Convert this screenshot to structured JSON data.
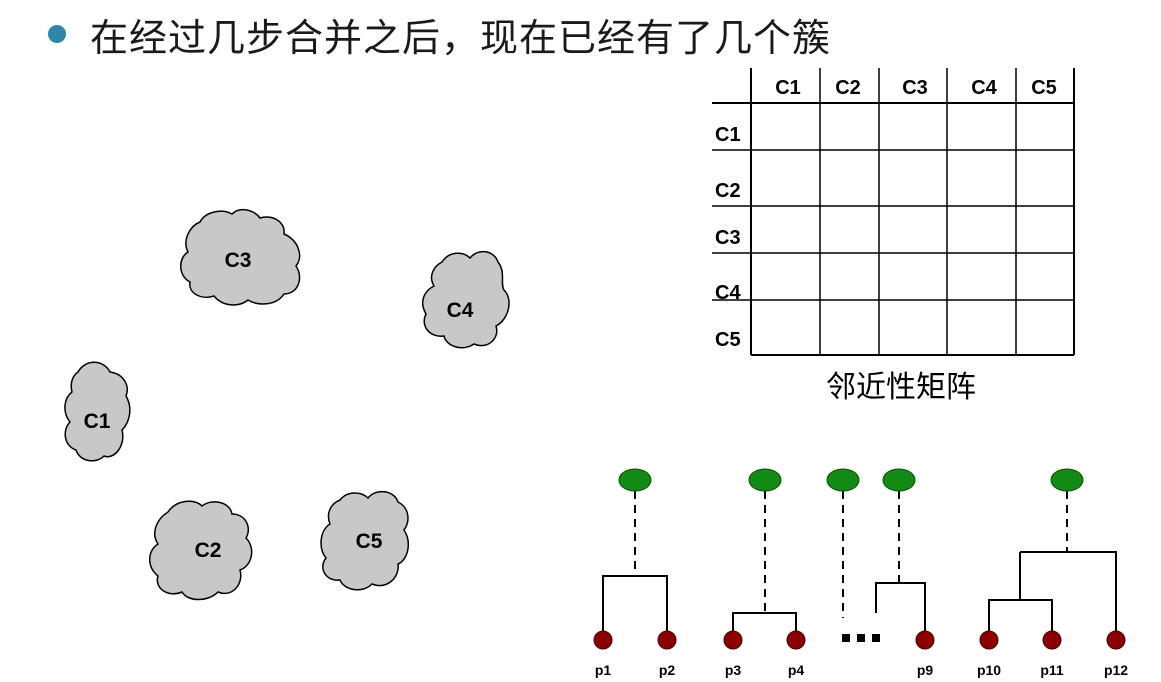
{
  "heading": {
    "text": "在经过几步合并之后，现在已经有了几个簇",
    "bullet_color": "#2e86a8"
  },
  "clusters": [
    {
      "label": "C3"
    },
    {
      "label": "C4"
    },
    {
      "label": "C1"
    },
    {
      "label": "C2"
    },
    {
      "label": "C5"
    }
  ],
  "cluster_fill": "#c8c8c8",
  "matrix": {
    "col_headers": [
      "C1",
      "C2",
      "C3",
      "C4",
      "C5"
    ],
    "row_headers": [
      "C1",
      "C2",
      "C3",
      "C4",
      "C5"
    ],
    "caption": "邻近性矩阵"
  },
  "dendrogram": {
    "leaves": [
      "p1",
      "p2",
      "p3",
      "p4",
      "p9",
      "p10",
      "p11",
      "p12"
    ],
    "root_color": "#138a13",
    "leaf_color": "#8b0000",
    "ellipsis": "■■■"
  }
}
